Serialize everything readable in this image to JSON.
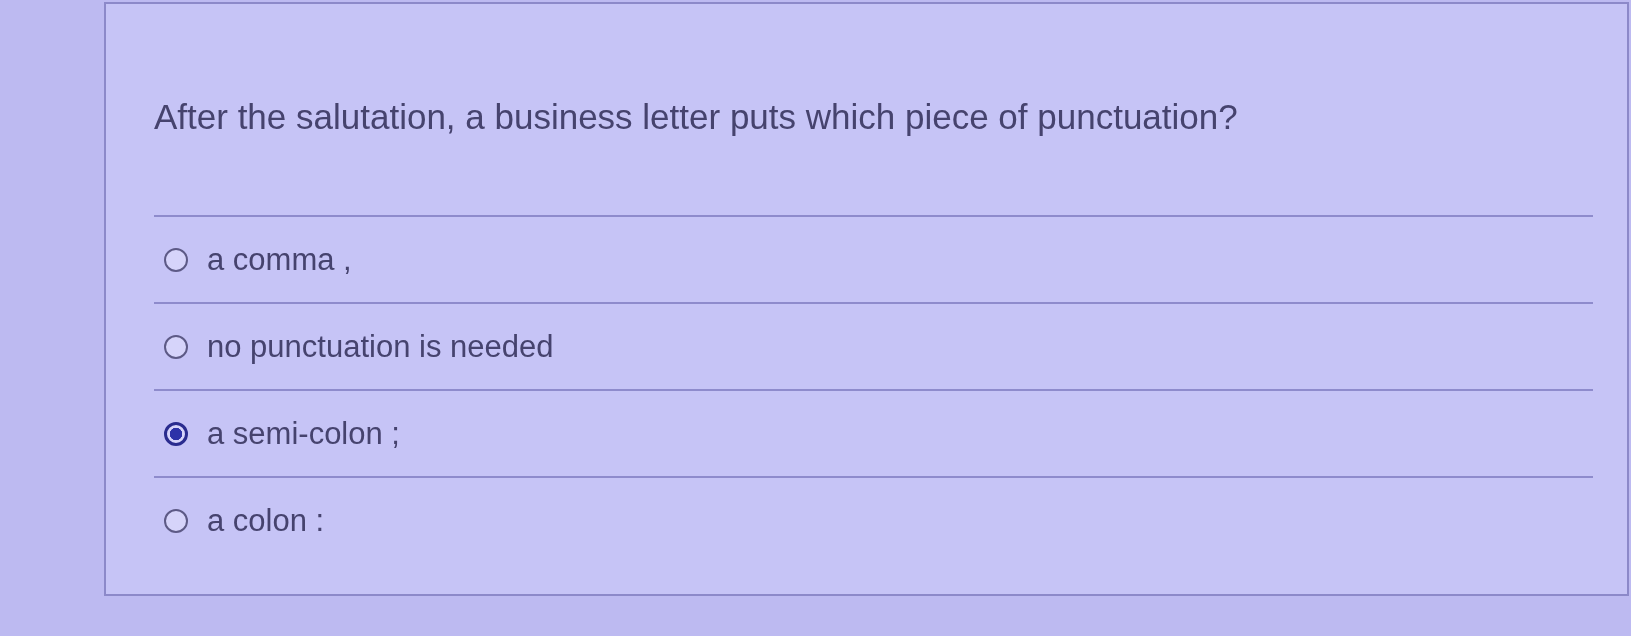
{
  "question": {
    "text": "After the salutation, a business letter puts which piece of punctuation?"
  },
  "options": [
    {
      "label": "a comma ,",
      "selected": false
    },
    {
      "label": "no punctuation is needed",
      "selected": false
    },
    {
      "label": "a semi-colon ;",
      "selected": true
    },
    {
      "label": "a colon :",
      "selected": false
    }
  ]
}
